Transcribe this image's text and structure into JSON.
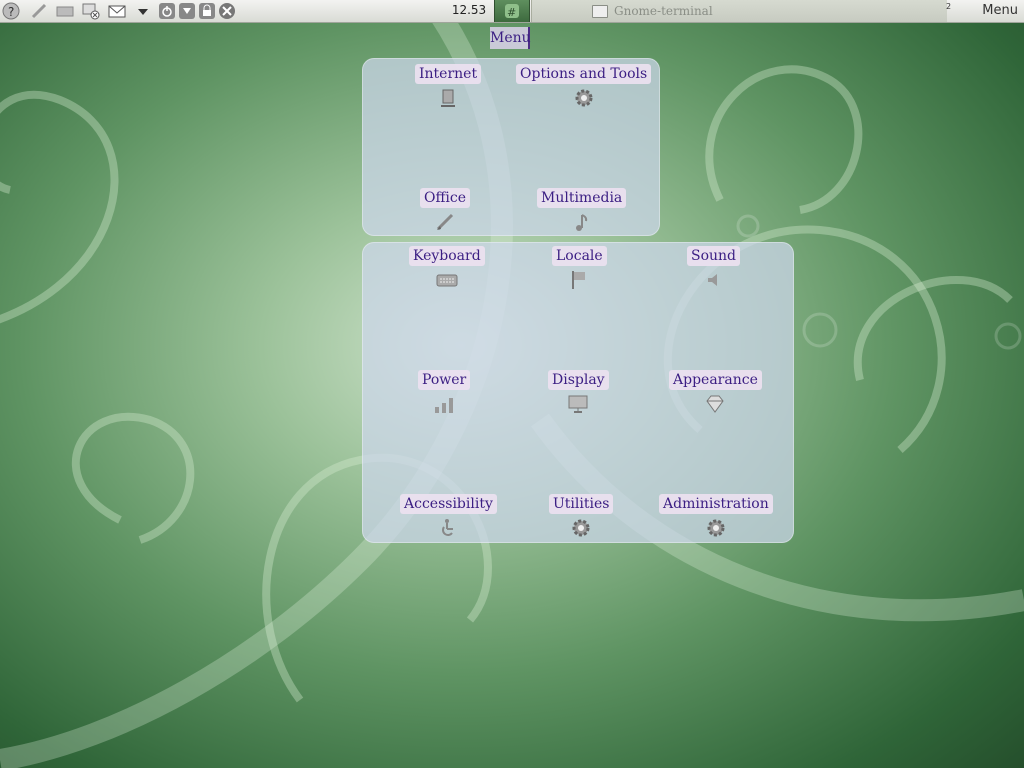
{
  "panel": {
    "clock": "12.53",
    "taskbar_window_title": "Gnome-terminal",
    "workspace_number": "2",
    "menu_label": "Menu"
  },
  "popup": {
    "title": "Menu",
    "groups": [
      {
        "items": [
          {
            "label": "Internet",
            "icon": "network-computer-icon"
          },
          {
            "label": "Options and Tools",
            "icon": "gear-icon"
          },
          {
            "label": "Office",
            "icon": "pen-icon"
          },
          {
            "label": "Multimedia",
            "icon": "music-note-icon"
          }
        ]
      },
      {
        "items": [
          {
            "label": "Keyboard",
            "icon": "keyboard-icon"
          },
          {
            "label": "Locale",
            "icon": "flag-icon"
          },
          {
            "label": "Sound",
            "icon": "speaker-icon"
          },
          {
            "label": "Power",
            "icon": "signal-bars-icon"
          },
          {
            "label": "Display",
            "icon": "monitor-icon"
          },
          {
            "label": "Appearance",
            "icon": "diamond-icon"
          },
          {
            "label": "Accessibility",
            "icon": "wheelchair-icon"
          },
          {
            "label": "Utilities",
            "icon": "gear-icon"
          },
          {
            "label": "Administration",
            "icon": "gear-icon"
          }
        ]
      }
    ]
  },
  "colors": {
    "label_text": "#3b1e83",
    "label_bg": "#ebe1f0",
    "popup_bg": "#cdd7eb",
    "wallpaper": "#4f8a55"
  }
}
